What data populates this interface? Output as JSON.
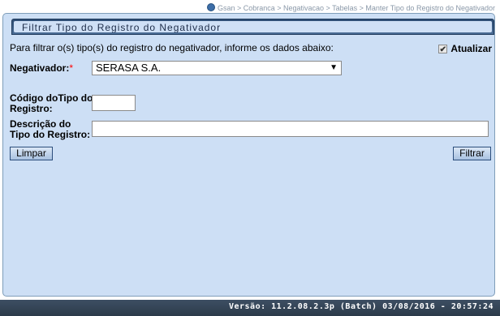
{
  "breadcrumb": {
    "items": [
      "Gsan",
      "Cobranca",
      "Negativacao",
      "Tabelas",
      "Manter Tipo do Registro do Negativador"
    ],
    "text": "Gsan  > Cobranca  > Negativacao  > Tabelas  > Manter Tipo do Registro do Negativador"
  },
  "page": {
    "title": "Filtrar Tipo do Registro do Negativador",
    "instructions": "Para filtrar o(s) tipo(s) do registro do negativador, informe os dados abaixo:"
  },
  "form": {
    "atualizar": {
      "label": "Atualizar",
      "checked": true,
      "mark": "✔"
    },
    "negativador": {
      "label": "Negativador:",
      "required_mark": "*",
      "selected": "SERASA S.A."
    },
    "codigo": {
      "label_line1": "Código doTipo do",
      "label_line2": "Registro:",
      "value": ""
    },
    "descricao": {
      "label_line1": "Descrição do",
      "label_line2": "Tipo do Registro:",
      "value": ""
    }
  },
  "buttons": {
    "limpar": "Limpar",
    "filtrar": "Filtrar"
  },
  "footer": {
    "version": "Versão: 11.2.08.2.3p (Batch) 03/08/2016 - 20:57:24"
  },
  "colors": {
    "panel": "#cddff5",
    "footer": "#2c3a4a",
    "title_text": "#1e2d49"
  }
}
